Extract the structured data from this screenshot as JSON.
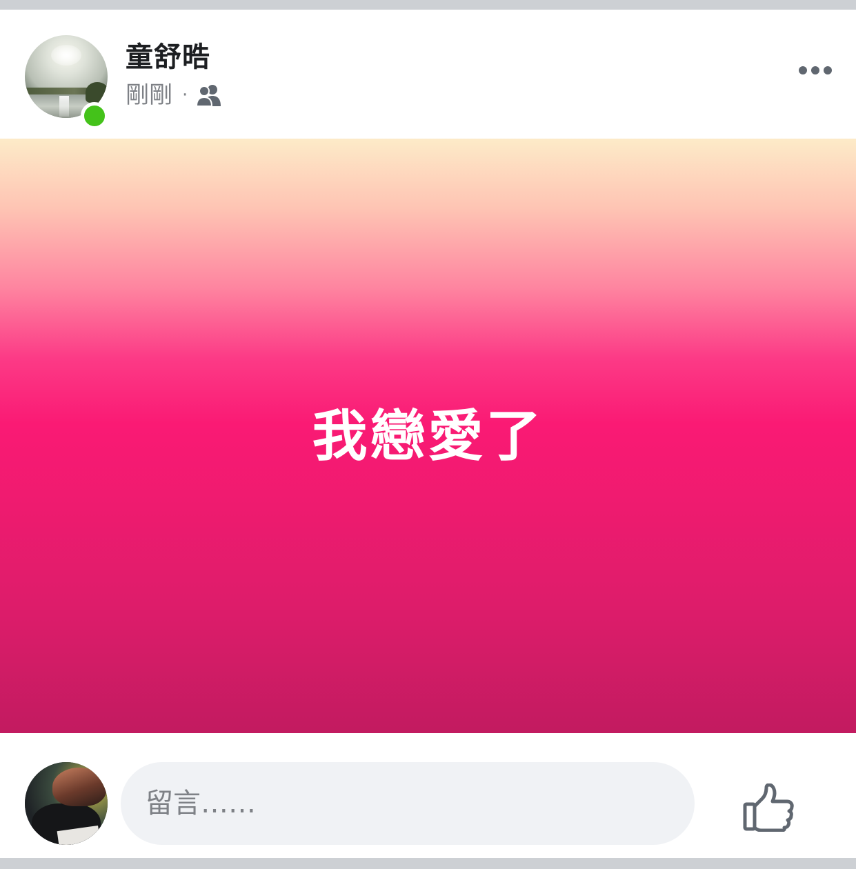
{
  "post": {
    "author_name": "童舒晧",
    "timestamp": "剛剛",
    "meta_separator": "·",
    "audience_icon": "friends-icon",
    "more_icon": "more-icon",
    "text": "我戀愛了",
    "background_gradient": [
      "#fdebc8",
      "#fe85a0",
      "#fa1a74",
      "#c21b60"
    ],
    "online_status_color": "#44c21a"
  },
  "comment": {
    "placeholder": "留言……",
    "like_icon": "thumbs-up-icon"
  }
}
